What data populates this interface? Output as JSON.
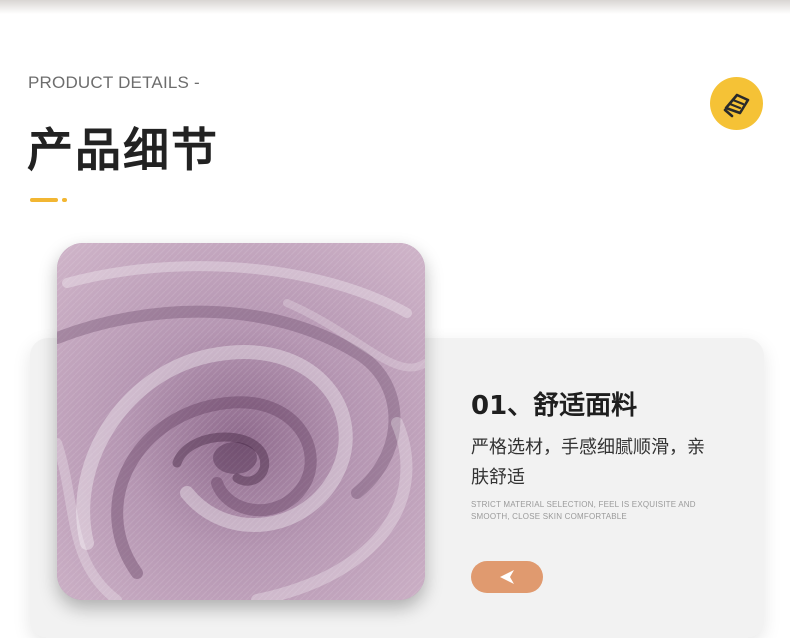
{
  "header": {
    "eyebrow": "PRODUCT DETAILS -",
    "title": "产品细节"
  },
  "badge": {
    "icon": "hand-fabric-icon",
    "color": "#f5c236"
  },
  "colors": {
    "accent": "#f2b632",
    "card_background": "#f2f2f2",
    "button": "#e09a6f",
    "fabric": "#b795b4"
  },
  "feature": {
    "heading": "01、舒适面料",
    "description": "严格选材，手感细腻顺滑，亲肤舒适",
    "english": "Strict material selection, feel is exquisite and smooth, close skin comfortable",
    "image_icon": "fabric-swirl-photo",
    "button_icon": "triangle-left-icon"
  }
}
